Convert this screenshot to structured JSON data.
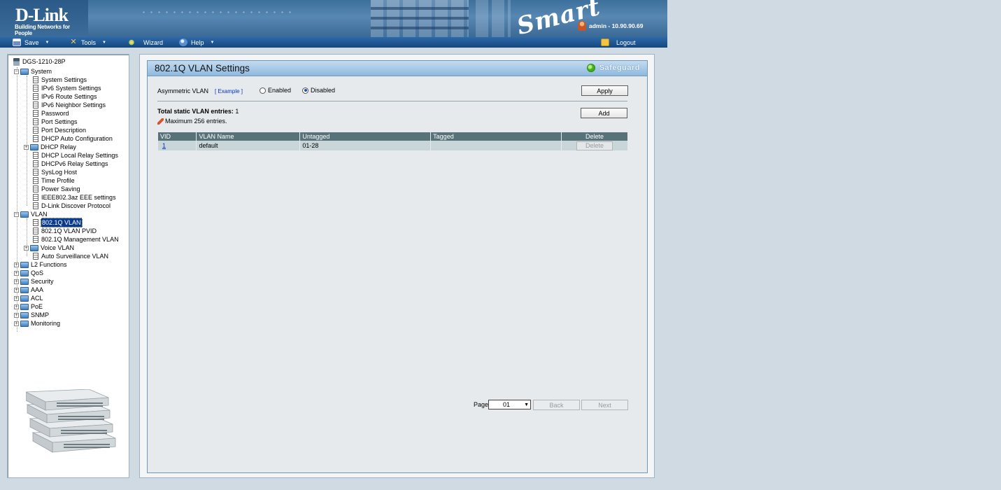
{
  "banner": {
    "logo": "D-Link",
    "tagline": "Building Networks for People",
    "product_mark": "Smart",
    "user_info": "admin - 10.90.90.69"
  },
  "toolbar": {
    "save": "Save",
    "tools": "Tools",
    "wizard": "Wizard",
    "help": "Help",
    "logout": "Logout"
  },
  "tree": {
    "root": "DGS-1210-28P",
    "system": "System",
    "system_items": [
      "System Settings",
      "IPv6 System Settings",
      "IPv6 Route Settings",
      "IPv6 Neighbor Settings",
      "Password",
      "Port Settings",
      "Port Description",
      "DHCP Auto Configuration",
      "DHCP Relay",
      "DHCP Local Relay Settings",
      "DHCPv6 Relay Settings",
      "SysLog Host",
      "Time Profile",
      "Power Saving",
      "IEEE802.3az EEE settings",
      "D-Link Discover Protocol"
    ],
    "vlan": "VLAN",
    "vlan_items": [
      "802.1Q VLAN",
      "802.1Q VLAN PVID",
      "802.1Q Management VLAN",
      "Voice VLAN",
      "Auto Surveillance VLAN"
    ],
    "top_items": [
      "L2 Functions",
      "QoS",
      "Security",
      "AAA",
      "ACL",
      "PoE",
      "SNMP",
      "Monitoring"
    ]
  },
  "page": {
    "title": "802.1Q VLAN Settings",
    "safeguard": "Safeguard",
    "asym_label": "Asymmetric VLAN",
    "example_link": "[ Example ]",
    "enabled_label": "Enabled",
    "disabled_label": "Disabled",
    "asym_value": "Disabled",
    "apply": "Apply",
    "total_label": "Total static VLAN entries:",
    "total_value": "1",
    "max_note": "Maximum 256 entries.",
    "add": "Add",
    "table_headers": [
      "VID",
      "VLAN Name",
      "Untagged",
      "Tagged",
      "Delete"
    ],
    "rows": [
      {
        "vid": "1",
        "name": "default",
        "untagged": "01-28",
        "tagged": "",
        "delete": "Delete"
      }
    ],
    "page_label": "Page",
    "page_value": "01",
    "back": "Back",
    "next": "Next"
  }
}
